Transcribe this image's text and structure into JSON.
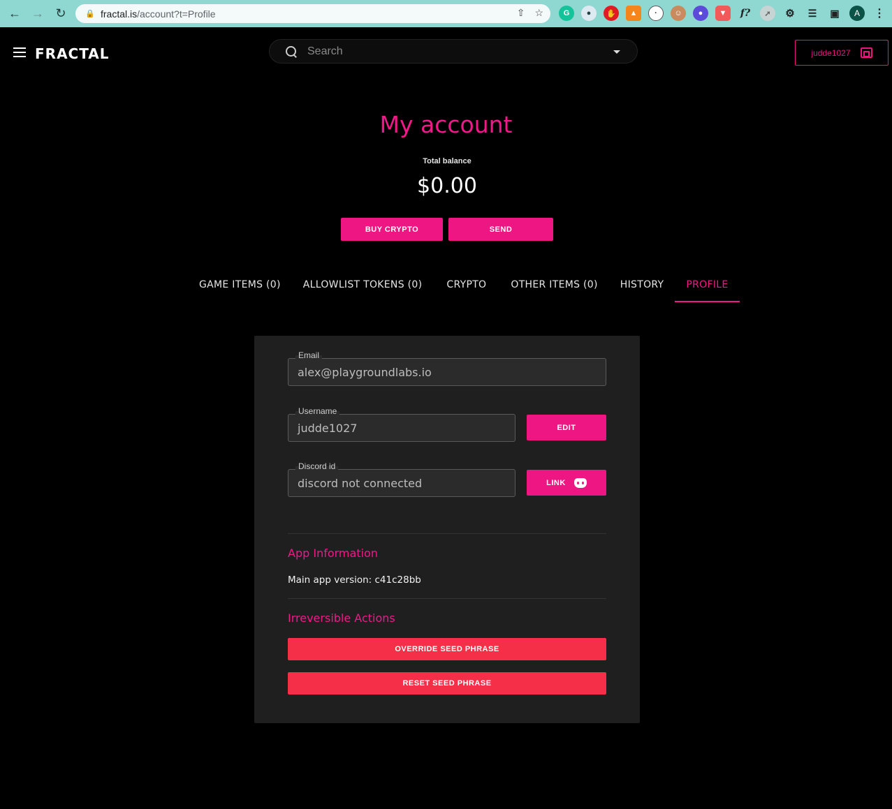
{
  "browser": {
    "url_domain": "fractal.is",
    "url_path": "/account?t=Profile",
    "profile_initial": "A",
    "ext_f_label": "f?"
  },
  "header": {
    "logo": "FRACTAL",
    "search_placeholder": "Search",
    "wallet_username": "judde1027"
  },
  "hero": {
    "title": "My account",
    "balance_label": "Total balance",
    "balance_value": "$0.00",
    "buy_label": "BUY CRYPTO",
    "send_label": "SEND"
  },
  "tabs": [
    {
      "label": "GAME ITEMS (0)"
    },
    {
      "label": "ALLOWLIST TOKENS (0)"
    },
    {
      "label": "CRYPTO"
    },
    {
      "label": "OTHER ITEMS (0)"
    },
    {
      "label": "HISTORY"
    },
    {
      "label": "PROFILE"
    }
  ],
  "profile": {
    "email_label": "Email",
    "email_value": "alex@playgroundlabs.io",
    "username_label": "Username",
    "username_value": "judde1027",
    "edit_label": "EDIT",
    "discord_label": "Discord id",
    "discord_value": "discord not connected",
    "link_label": "LINK",
    "app_info_title": "App Information",
    "version_text": "Main app version: c41c28bb",
    "irreversible_title": "Irreversible Actions",
    "override_label": "OVERRIDE SEED PHRASE",
    "reset_label": "RESET SEED PHRASE"
  },
  "colors": {
    "accent": "#f0198a",
    "danger": "#f42f47",
    "browser_bar": "#8fd7d1"
  }
}
